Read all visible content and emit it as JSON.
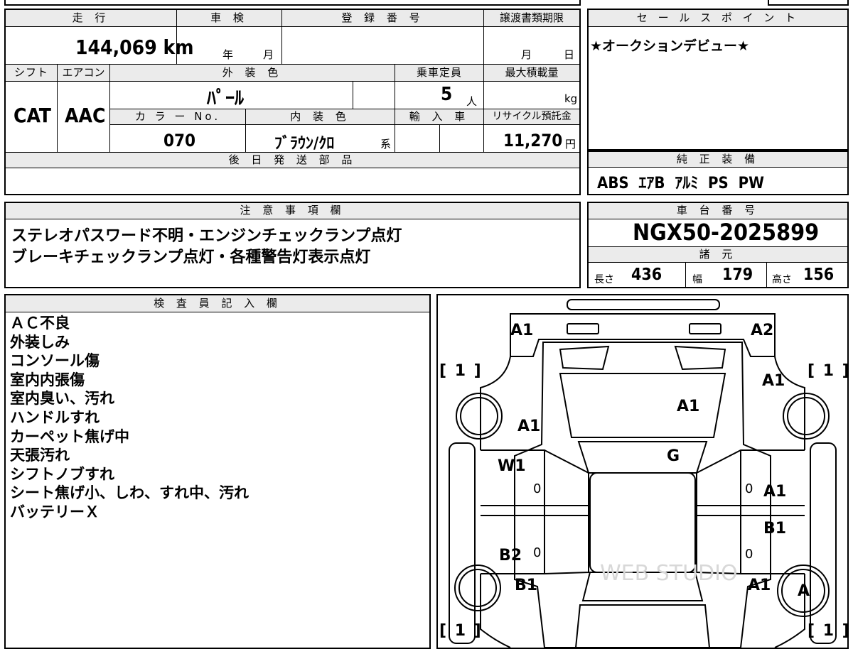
{
  "top_spec": {
    "mileage_header": "走 行",
    "mileage_value": "144,069 km",
    "inspection_header": "車 検",
    "inspection_year_unit": "年",
    "inspection_month_unit": "月",
    "registration_header": "登 録 番 号",
    "transfer_header": "譲渡書類期限",
    "transfer_month_unit": "月",
    "transfer_day_unit": "日",
    "shift_header": "シフト",
    "shift_value": "CAT",
    "aircon_header": "エアコン",
    "aircon_value": "AAC",
    "exterior_color_header": "外 装 色",
    "exterior_color_value": "ﾊﾟｰﾙ",
    "capacity_header": "乗車定員",
    "capacity_value": "5",
    "capacity_unit": "人",
    "max_load_header": "最大積載量",
    "max_load_unit": "kg",
    "color_no_header": "カ ラ ー No.",
    "color_no_value": "070",
    "interior_color_header": "内 装 色",
    "interior_color_value": "ﾌﾞﾗｳﾝ/ｸﾛ",
    "interior_color_suffix": "系",
    "import_header": "輸 入 車",
    "recycle_header": "リサイクル預託金",
    "recycle_value": "11,270",
    "recycle_unit": "円",
    "later_parts_header": "後 日 発 送 部 品"
  },
  "sales_point": {
    "header": "セ ー ル ス ポ イ ン ト",
    "text": "★オークションデビュー★"
  },
  "equipment": {
    "header": "純 正 装 備",
    "items": "ABS  ｴｱB  ｱﾙﾐ  PS  PW"
  },
  "notes": {
    "header": "注 意 事 項 欄",
    "line1": "ステレオパスワード不明・エンジンチェックランプ点灯",
    "line2": "ブレーキチェックランプ点灯・各種警告灯表示点灯"
  },
  "chassis": {
    "header": "車 台 番 号",
    "value": "NGX50-2025899",
    "spec_header": "諸 元",
    "length_label": "長さ",
    "length_value": "436",
    "width_label": "幅",
    "width_value": "179",
    "height_label": "高さ",
    "height_value": "156"
  },
  "inspector": {
    "header": "検 査 員 記 入 欄",
    "lines": [
      "ＡＣ不良",
      "外装しみ",
      "コンソール傷",
      "室内内張傷",
      "室内臭い、汚れ",
      "ハンドルすれ",
      "カーペット焦げ中",
      "天張汚れ",
      "シフトノブすれ",
      "シート焦げ小、しわ、すれ中、汚れ",
      "バッテリーＸ"
    ]
  },
  "diagram_marks": {
    "front_left": "A1",
    "front_right": "A2",
    "tire_front_left": "[ 1 ]",
    "tire_front_right": "[ 1 ]",
    "tire_rear_left": "[ 1 ]",
    "tire_rear_right": "[ 1 ]",
    "fender_front_right": "A1",
    "hood": "A1",
    "fender_front_left": "A1",
    "windshield": "G",
    "door_front_left": "W1",
    "door_front_left_zero": "0",
    "door_front_right_zero": "0",
    "door_front_right": "A1",
    "door_rear_right": "B1",
    "door_rear_left": "B2",
    "door_rear_left_zero": "0",
    "door_rear_right_zero": "0",
    "fender_rear_left": "B1",
    "fender_rear_right": "A1",
    "wheel_rear_right": "A",
    "watermark": "WEB STUDIO"
  }
}
